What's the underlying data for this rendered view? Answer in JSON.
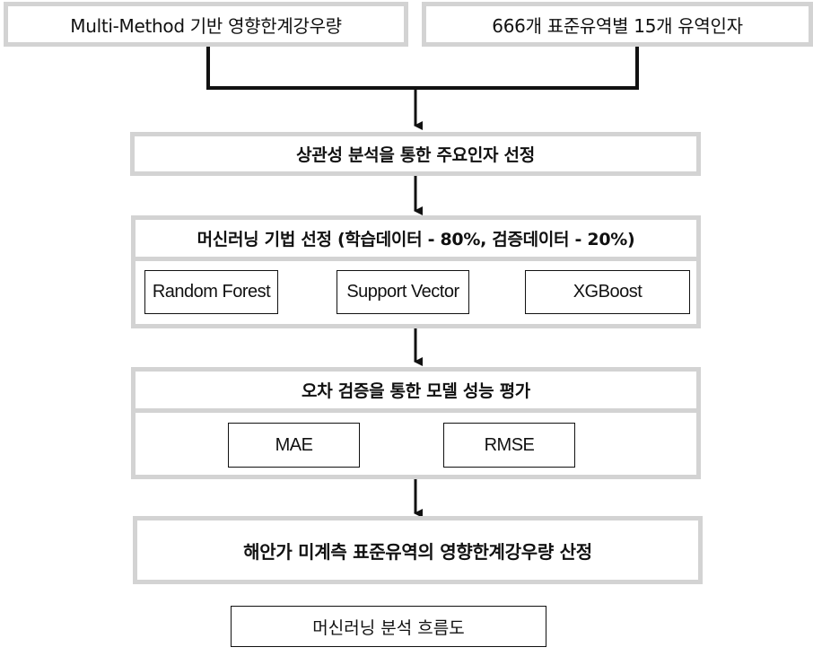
{
  "diagram": {
    "inputs": [
      {
        "label": "Multi-Method 기반 영향한계강우량"
      },
      {
        "label": "666개 표준유역별 15개 유역인자"
      }
    ],
    "step_correlation": {
      "label": "상관성 분석을 통한 주요인자 선정"
    },
    "step_ml_selection": {
      "label": "머신러닝 기법 선정 (학습데이터 - 80%, 검증데이터 - 20%)",
      "methods": [
        "Random Forest",
        "Support Vector",
        "XGBoost"
      ]
    },
    "step_evaluation": {
      "label": "오차 검증을 통한 모델 성능 평가",
      "metrics": [
        "MAE",
        "RMSE"
      ]
    },
    "step_output": {
      "label": "해안가 미계측 표준유역의 영향한계강우량 산정"
    },
    "caption": "머신러닝 분석 흐름도"
  },
  "colors": {
    "box_border": "#d3d3d3",
    "line": "#111111"
  }
}
